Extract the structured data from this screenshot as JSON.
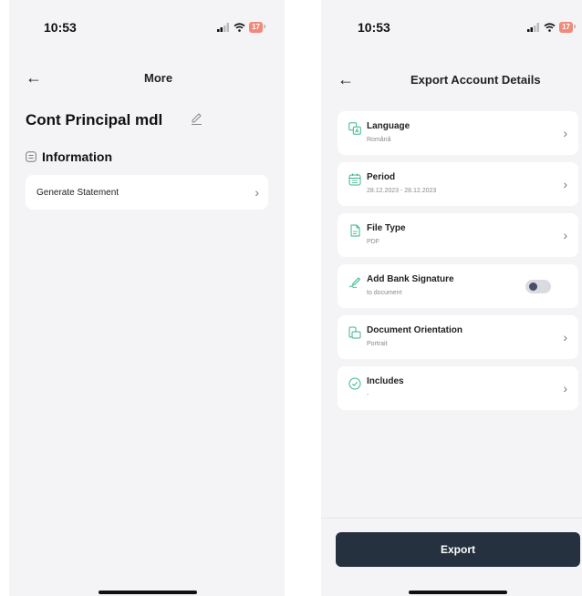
{
  "left": {
    "time": "10:53",
    "battery": "17",
    "title": "More",
    "account_name": "Cont Principal mdl",
    "section_label": "Information",
    "items": [
      {
        "label": "Generate Statement"
      }
    ]
  },
  "right": {
    "time": "10:53",
    "battery": "17",
    "title": "Export Account Details",
    "options": [
      {
        "title": "Language",
        "subtitle": "Română",
        "icon": "translate-icon"
      },
      {
        "title": "Period",
        "subtitle": "28.12.2023 - 28.12.2023",
        "icon": "calendar-icon"
      },
      {
        "title": "File Type",
        "subtitle": "PDF",
        "icon": "file-icon"
      },
      {
        "title": "Add Bank Signature",
        "subtitle": "to document",
        "icon": "signature-icon",
        "toggle_on": false
      },
      {
        "title": "Document Orientation",
        "subtitle": "Portrait",
        "icon": "orientation-icon"
      },
      {
        "title": "Includes",
        "subtitle": "-",
        "icon": "check-circle-icon"
      }
    ],
    "export_label": "Export"
  },
  "colors": {
    "background": "#f4f4f6",
    "card": "#ffffff",
    "accent_green": "#3bb58a",
    "button": "#26313f",
    "battery": "#f08a7a"
  }
}
